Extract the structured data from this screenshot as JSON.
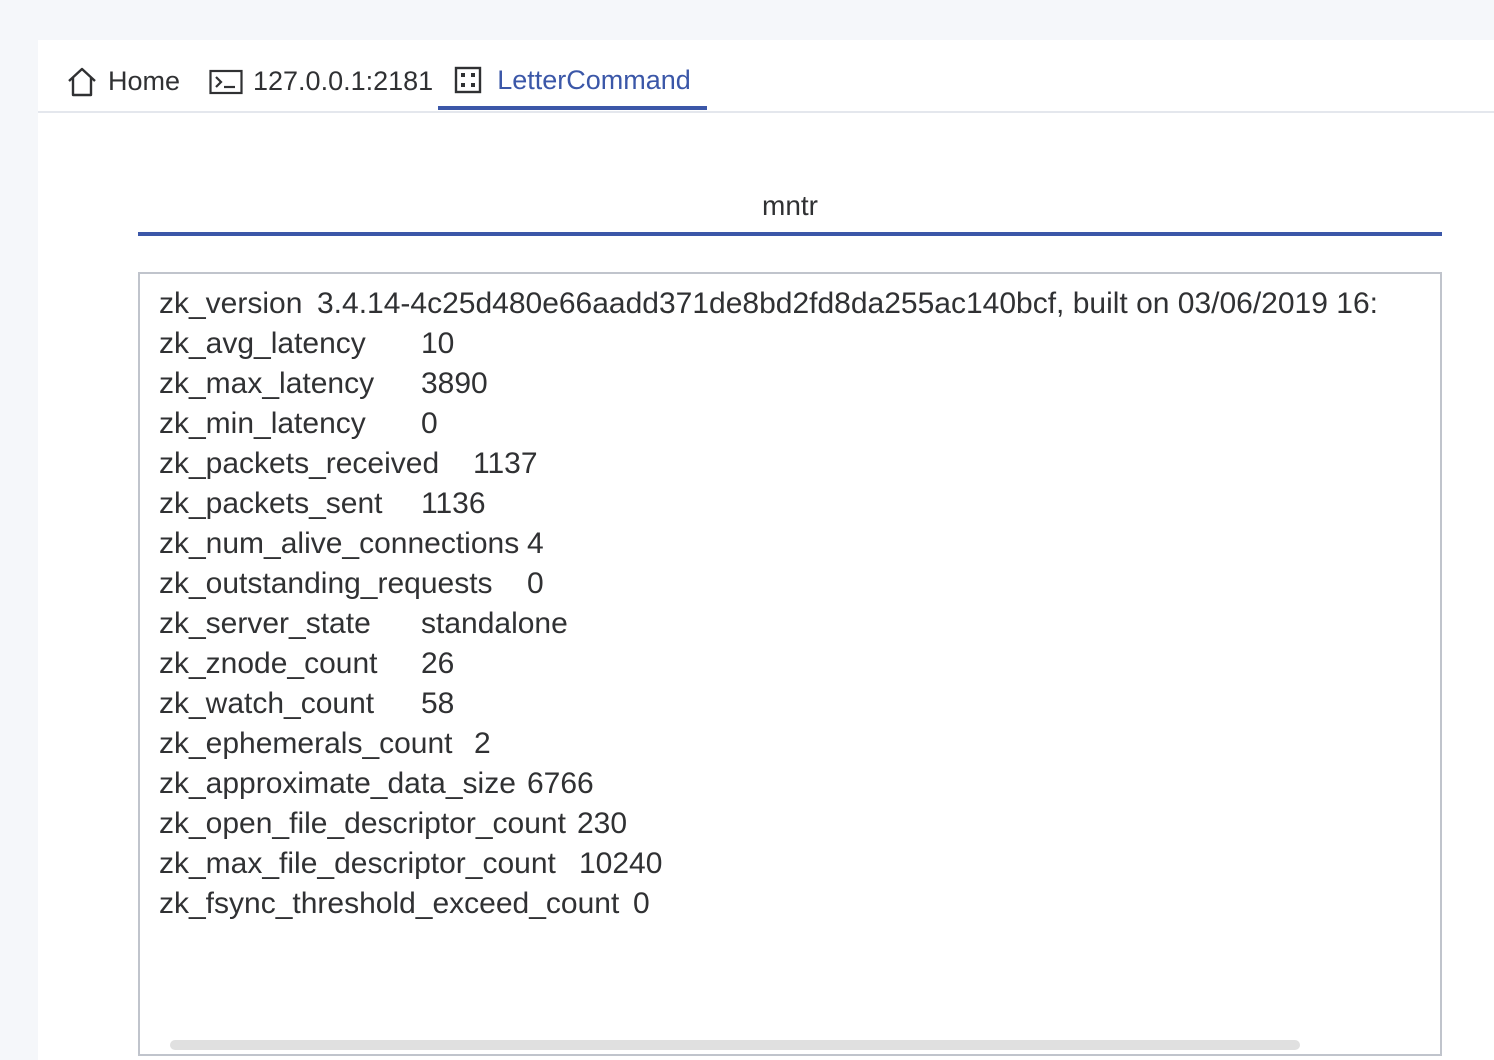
{
  "tabs": [
    {
      "label": "Home",
      "icon": "home-icon"
    },
    {
      "label": "127.0.0.1:2181",
      "icon": "terminal-icon"
    },
    {
      "label": "LetterCommand",
      "icon": "command-icon",
      "active": true
    }
  ],
  "command": {
    "value": "mntr"
  },
  "output": [
    {
      "key": "zk_version",
      "value": "3.4.14-4c25d480e66aadd371de8bd2fd8da255ac140bcf, built on 03/06/2019 16:"
    },
    {
      "key": "zk_avg_latency",
      "value": "10"
    },
    {
      "key": "zk_max_latency",
      "value": "3890"
    },
    {
      "key": "zk_min_latency",
      "value": "0"
    },
    {
      "key": "zk_packets_received",
      "value": "1137"
    },
    {
      "key": "zk_packets_sent",
      "value": "1136"
    },
    {
      "key": "zk_num_alive_connections",
      "value": "4"
    },
    {
      "key": "zk_outstanding_requests",
      "value": "0"
    },
    {
      "key": "zk_server_state",
      "value": "standalone"
    },
    {
      "key": "zk_znode_count",
      "value": "26"
    },
    {
      "key": "zk_watch_count",
      "value": "58"
    },
    {
      "key": "zk_ephemerals_count",
      "value": "2"
    },
    {
      "key": "zk_approximate_data_size",
      "value": "6766"
    },
    {
      "key": "zk_open_file_descriptor_count",
      "value": "230"
    },
    {
      "key": "zk_max_file_descriptor_count",
      "value": "10240"
    },
    {
      "key": "zk_fsync_threshold_exceed_count",
      "value": "0"
    }
  ],
  "colors": {
    "accent": "#3b57a8",
    "text": "#303133",
    "background": "#f5f7fa"
  }
}
